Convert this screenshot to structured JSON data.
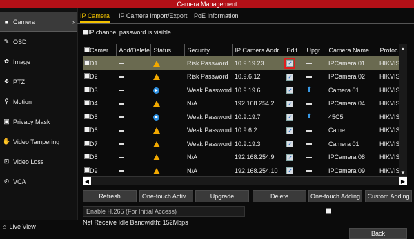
{
  "window": {
    "title": "Camera Management"
  },
  "sidebar": {
    "items": [
      {
        "label": "Camera",
        "icon": "camera-icon"
      },
      {
        "label": "OSD",
        "icon": "osd-icon"
      },
      {
        "label": "Image",
        "icon": "image-icon"
      },
      {
        "label": "PTZ",
        "icon": "ptz-icon"
      },
      {
        "label": "Motion",
        "icon": "motion-icon"
      },
      {
        "label": "Privacy Mask",
        "icon": "privacy-mask-icon"
      },
      {
        "label": "Video Tampering",
        "icon": "video-tampering-icon"
      },
      {
        "label": "Video Loss",
        "icon": "video-loss-icon"
      },
      {
        "label": "VCA",
        "icon": "vca-icon"
      }
    ],
    "live_view": "Live View"
  },
  "tabs": [
    {
      "label": "IP Camera"
    },
    {
      "label": "IP Camera Import/Export"
    },
    {
      "label": "PoE Information"
    }
  ],
  "password_visible_label": "IP channel password is visible.",
  "table": {
    "headers": [
      "Camer...",
      "Add/Delete",
      "Status",
      "Security",
      "IP Camera Addr...",
      "Edit",
      "Upgr...",
      "Camera Name",
      "Protoc"
    ],
    "rows": [
      {
        "camera": "D1",
        "status": "warning",
        "security": "Risk Password",
        "ip": "10.9.19.23",
        "upgrade": "dash",
        "name": "IPCamera 01",
        "protocol": "HIKVIS"
      },
      {
        "camera": "D2",
        "status": "warning",
        "security": "Risk Password",
        "ip": "10.9.6.12",
        "upgrade": "dash",
        "name": "IPCamera 02",
        "protocol": "HIKVIS"
      },
      {
        "camera": "D3",
        "status": "playing",
        "security": "Weak Password",
        "ip": "10.9.19.6",
        "upgrade": "up",
        "name": "Camera 01",
        "protocol": "HIKVIS"
      },
      {
        "camera": "D4",
        "status": "warning",
        "security": "N/A",
        "ip": "192.168.254.2",
        "upgrade": "dash",
        "name": "IPCamera 04",
        "protocol": "HIKVIS"
      },
      {
        "camera": "D5",
        "status": "playing",
        "security": "Weak Password",
        "ip": "10.9.19.7",
        "upgrade": "up",
        "name": "45C5",
        "protocol": "HIKVIS"
      },
      {
        "camera": "D6",
        "status": "warning",
        "security": "Weak Password",
        "ip": "10.9.6.2",
        "upgrade": "dash",
        "name": "Came",
        "protocol": "HIKVIS"
      },
      {
        "camera": "D7",
        "status": "warning",
        "security": "Weak Password",
        "ip": "10.9.19.3",
        "upgrade": "dash",
        "name": "Camera 01",
        "protocol": "HIKVIS"
      },
      {
        "camera": "D8",
        "status": "warning",
        "security": "N/A",
        "ip": "192.168.254.9",
        "upgrade": "dash",
        "name": "IPCamera 08",
        "protocol": "HIKVIS"
      },
      {
        "camera": "D9",
        "status": "warning",
        "security": "N/A",
        "ip": "192.168.254.10",
        "upgrade": "dash",
        "name": "IPCamera 09",
        "protocol": "HIKVIS"
      }
    ]
  },
  "buttons": {
    "refresh": "Refresh",
    "one_touch_activate": "One-touch Activ...",
    "upgrade": "Upgrade",
    "delete": "Delete",
    "one_touch_adding": "One-touch Adding",
    "custom_adding": "Custom Adding"
  },
  "h265_label": "Enable H.265 (For Initial Access)",
  "bandwidth": "Net Receive Idle Bandwidth: 152Mbps",
  "back": "Back",
  "colors": {
    "accent": "#f2c200",
    "title_bar": "#b31017",
    "selected_row": "#6a6a50"
  }
}
